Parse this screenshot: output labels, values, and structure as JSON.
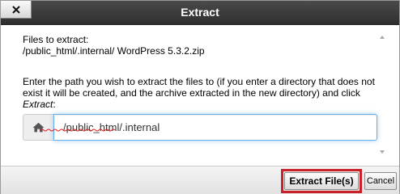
{
  "dialog": {
    "title": "Extract",
    "close_icon": "close-icon"
  },
  "files": {
    "label": "Files to extract:",
    "path": "/public_html/.internal/ WordPress 5.3.2.zip"
  },
  "instructions": {
    "text_before": "Enter the path you wish to extract the files to (if you enter a directory that does not exist it will be created, and the archive extracted in the new directory) and click ",
    "action_word": "Extract",
    "text_after": ":"
  },
  "path_input": {
    "icon": "home-icon",
    "value": "/public_html/.internal"
  },
  "footer": {
    "extract_label": "Extract File(s)",
    "cancel_label": "Cancel",
    "highlight_color": "#cc1f2a"
  },
  "colors": {
    "titlebar": "#333333",
    "input_focus_border": "#66afe9"
  }
}
